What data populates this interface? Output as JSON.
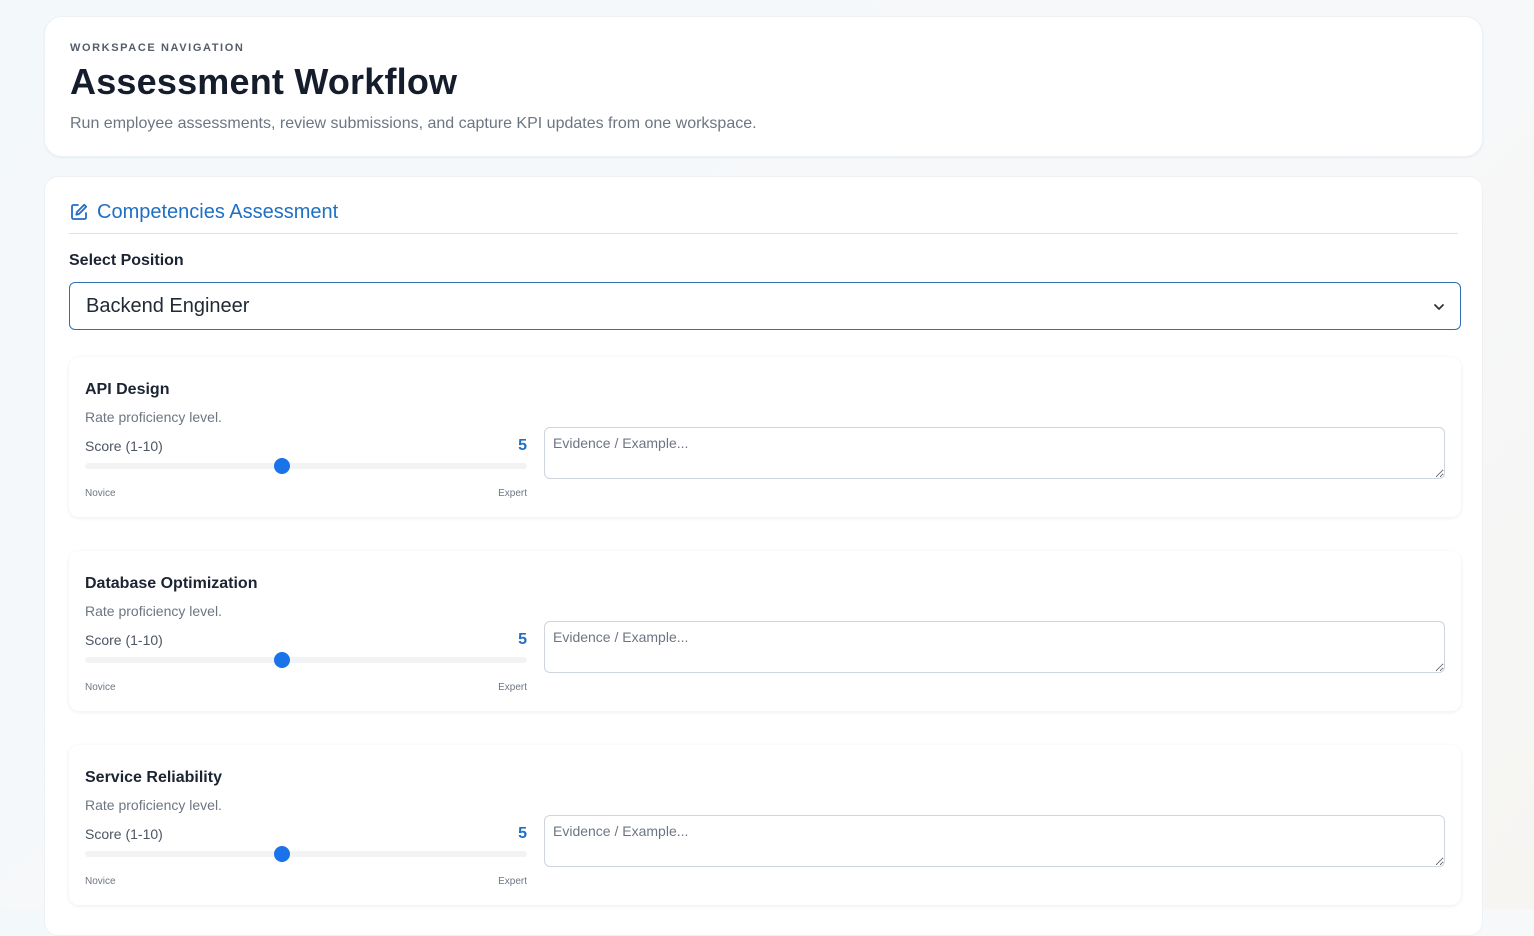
{
  "header": {
    "eyebrow": "WORKSPACE NAVIGATION",
    "title": "Assessment Workflow",
    "subtitle": "Run employee assessments, review submissions, and capture KPI updates from one workspace."
  },
  "section": {
    "icon": "edit-icon",
    "title": "Competencies Assessment"
  },
  "position_select": {
    "label": "Select Position",
    "value": "Backend Engineer"
  },
  "competencies": [
    {
      "name": "API Design",
      "description": "Rate proficiency level.",
      "score_label": "Score (1-10)",
      "score": "5",
      "min_label": "Novice",
      "max_label": "Expert",
      "evidence_placeholder": "Evidence / Example..."
    },
    {
      "name": "Database Optimization",
      "description": "Rate proficiency level.",
      "score_label": "Score (1-10)",
      "score": "5",
      "min_label": "Novice",
      "max_label": "Expert",
      "evidence_placeholder": "Evidence / Example..."
    },
    {
      "name": "Service Reliability",
      "description": "Rate proficiency level.",
      "score_label": "Score (1-10)",
      "score": "5",
      "min_label": "Novice",
      "max_label": "Expert",
      "evidence_placeholder": "Evidence / Example..."
    }
  ],
  "colors": {
    "accent": "#1f6fc4",
    "slider_thumb": "#1a73e8"
  }
}
